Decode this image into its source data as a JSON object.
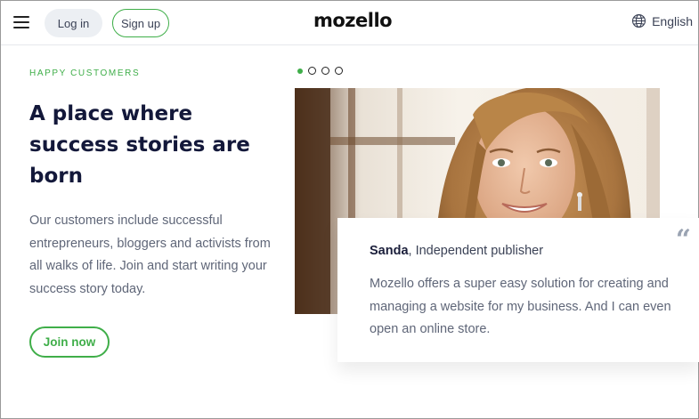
{
  "header": {
    "login_label": "Log in",
    "signup_label": "Sign up",
    "logo_text": "mozello",
    "language_label": "English"
  },
  "hero": {
    "eyebrow": "HAPPY CUSTOMERS",
    "headline_lines": [
      "A place where",
      "success stories are",
      "born"
    ],
    "description": "Our customers include successful entrepreneurs, bloggers and activists from all walks of life. Join and start writing your success story today.",
    "join_label": "Join now"
  },
  "carousel": {
    "slide_count": 4,
    "active_index": 0
  },
  "testimonial": {
    "author_name": "Sanda",
    "author_role": ", Independent publisher",
    "quote": "Mozello offers a super easy solution for creating and managing a website for my business. And I can even open an online store.",
    "quote_mark": "“"
  },
  "colors": {
    "accent": "#3fae49",
    "heading": "#13183a",
    "body_text": "#5f6678"
  },
  "icons": {
    "menu": "hamburger-icon",
    "language": "globe-icon",
    "quote": "quote-icon"
  }
}
